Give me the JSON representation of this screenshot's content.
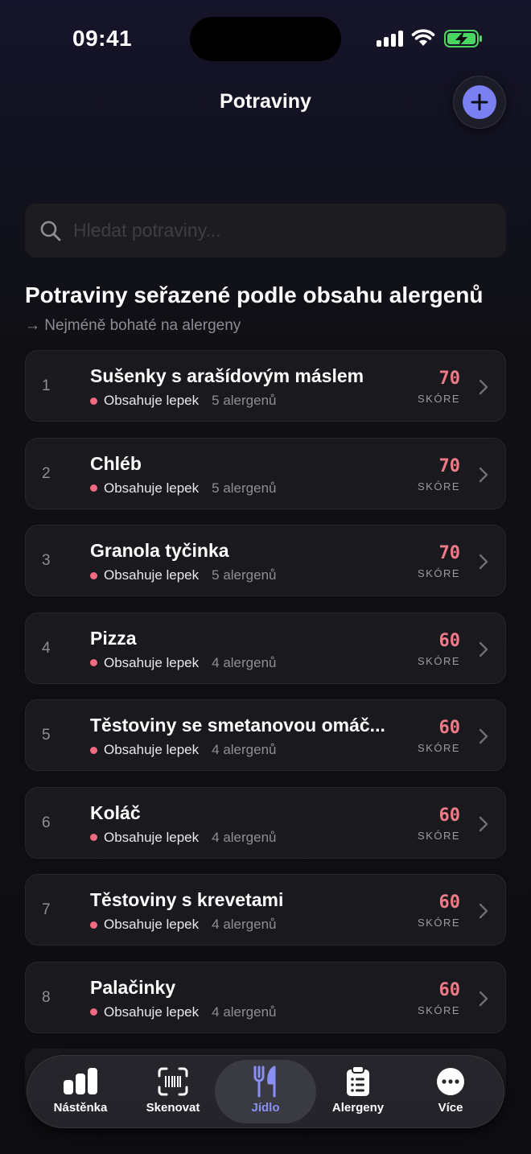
{
  "status": {
    "time": "09:41"
  },
  "header": {
    "title": "Potraviny",
    "add_icon": "plus-icon"
  },
  "search": {
    "placeholder": "Hledat potraviny..."
  },
  "section": {
    "title": "Potraviny seřazené podle obsahu alergenů",
    "subtitle": "→ Nejméně bohaté na alergeny"
  },
  "colors": {
    "accent": "#7a80f2",
    "score": "#f07a88",
    "tag_dot": "#f06a80",
    "background": "#0e0e11",
    "card": "#1a1a1e"
  },
  "items": [
    {
      "rank": "1",
      "name": "Sušenky s arašídovým máslem",
      "tag": "Obsahuje lepek",
      "count": "5 alergenů",
      "score": "70",
      "score_label": "SKÓRE"
    },
    {
      "rank": "2",
      "name": "Chléb",
      "tag": "Obsahuje lepek",
      "count": "5 alergenů",
      "score": "70",
      "score_label": "SKÓRE"
    },
    {
      "rank": "3",
      "name": "Granola tyčinka",
      "tag": "Obsahuje lepek",
      "count": "5 alergenů",
      "score": "70",
      "score_label": "SKÓRE"
    },
    {
      "rank": "4",
      "name": "Pizza",
      "tag": "Obsahuje lepek",
      "count": "4 alergenů",
      "score": "60",
      "score_label": "SKÓRE"
    },
    {
      "rank": "5",
      "name": "Těstoviny se smetanovou omáč...",
      "tag": "Obsahuje lepek",
      "count": "4 alergenů",
      "score": "60",
      "score_label": "SKÓRE"
    },
    {
      "rank": "6",
      "name": "Koláč",
      "tag": "Obsahuje lepek",
      "count": "4 alergenů",
      "score": "60",
      "score_label": "SKÓRE"
    },
    {
      "rank": "7",
      "name": "Těstoviny s krevetami",
      "tag": "Obsahuje lepek",
      "count": "4 alergenů",
      "score": "60",
      "score_label": "SKÓRE"
    },
    {
      "rank": "8",
      "name": "Palačinky",
      "tag": "Obsahuje lepek",
      "count": "4 alergenů",
      "score": "60",
      "score_label": "SKÓRE"
    }
  ],
  "tabs": [
    {
      "label": "Nástěnka",
      "icon": "chart-bars-icon",
      "active": false
    },
    {
      "label": "Skenovat",
      "icon": "barcode-scan-icon",
      "active": false
    },
    {
      "label": "Jídlo",
      "icon": "fork-knife-icon",
      "active": true
    },
    {
      "label": "Alergeny",
      "icon": "clipboard-list-icon",
      "active": false
    },
    {
      "label": "Více",
      "icon": "more-dots-icon",
      "active": false
    }
  ]
}
